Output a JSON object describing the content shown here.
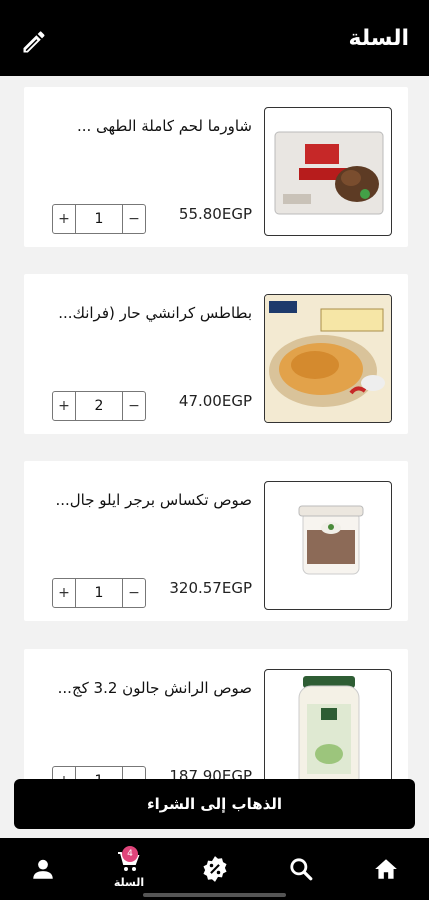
{
  "header": {
    "title": "السلة"
  },
  "items": [
    {
      "name": "شاورما لحم كاملة الطهى ...",
      "price": "55.80EGP",
      "qty": "1",
      "minus": "−",
      "plus": "+"
    },
    {
      "name": "بطاطس كرانشي حار (فرانك...",
      "price": "47.00EGP",
      "qty": "2",
      "minus": "−",
      "plus": "+"
    },
    {
      "name": "صوص تكساس برجر ايلو جال...",
      "price": "320.57EGP",
      "qty": "1",
      "minus": "−",
      "plus": "+"
    },
    {
      "name": "صوص الرانش جالون 3.2 كج...",
      "price": "187.90EGP",
      "qty": "1",
      "minus": "−",
      "plus": "+"
    }
  ],
  "checkout": {
    "label": "الذهاب إلى الشراء"
  },
  "nav": {
    "cart_label": "السلة",
    "cart_count": "4"
  },
  "colors": {
    "background": "#f2f2f2",
    "header": "#000000",
    "badge": "#e0457b"
  }
}
